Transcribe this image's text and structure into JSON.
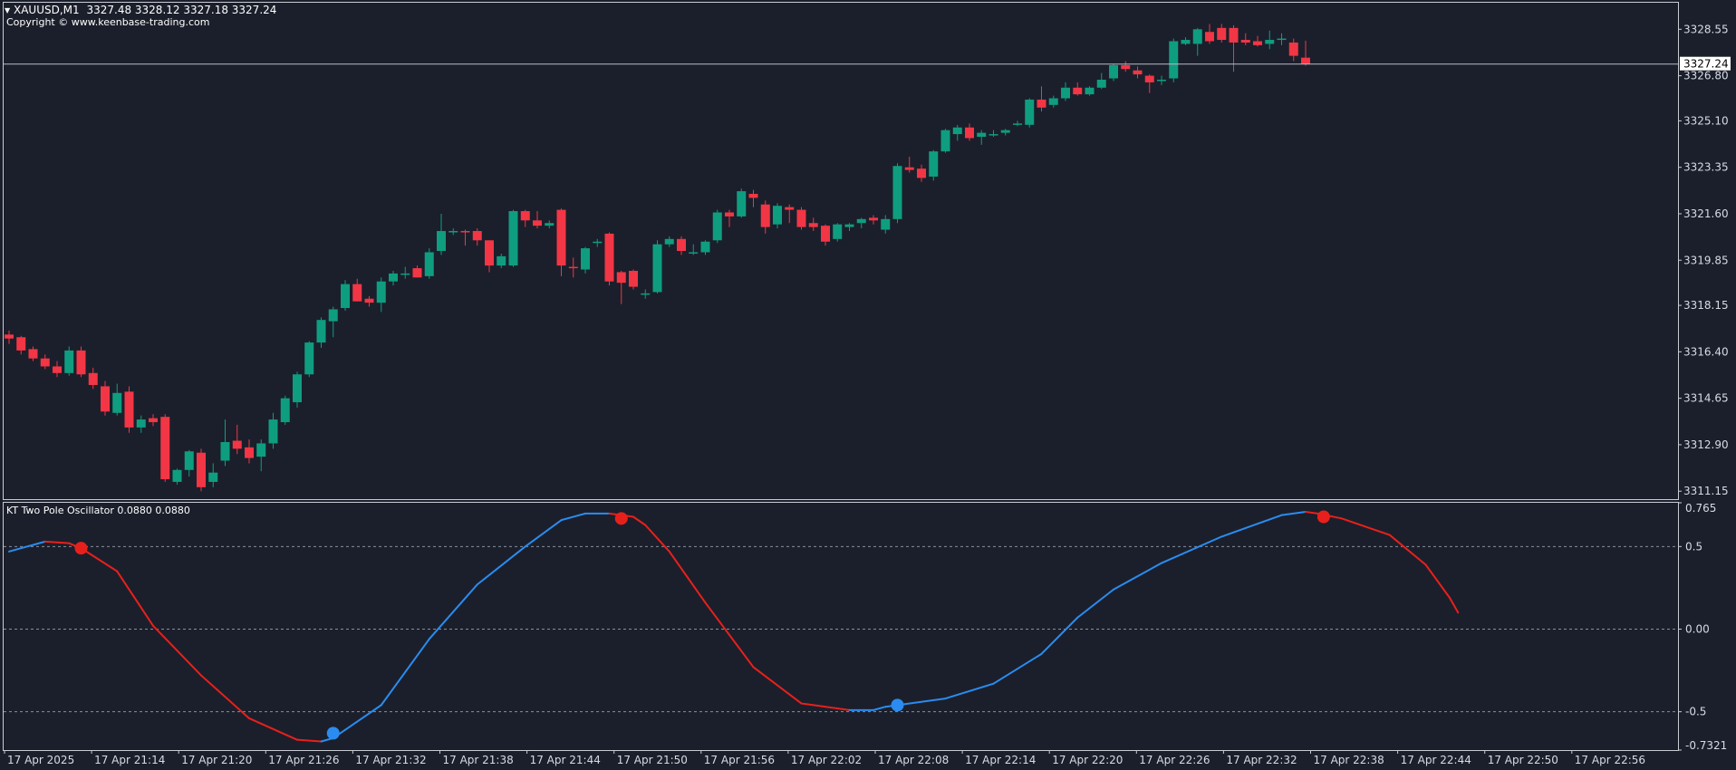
{
  "header": {
    "symbol": "XAUUSD,M1",
    "ohlc": "3327.48 3328.12 3327.18 3327.24",
    "copyright": "Copyright © www.keenbase-trading.com"
  },
  "indicator": {
    "label": "KT Two Pole Oscillator 0.0880 0.0880"
  },
  "chart_data": [
    {
      "type": "candlestick",
      "title": "XAUUSD,M1",
      "price_ticks": [
        3328.55,
        3326.8,
        3325.1,
        3323.35,
        3321.6,
        3319.85,
        3318.15,
        3316.4,
        3314.65,
        3312.9,
        3311.15
      ],
      "price_tick_labels": [
        "3328.55",
        "3326.80",
        "3325.10",
        "3323.35",
        "3321.60",
        "3319.85",
        "3318.15",
        "3316.40",
        "3314.65",
        "3312.90",
        "3311.15"
      ],
      "ylim": [
        3310.85,
        3329.55
      ],
      "current_price": 3327.24,
      "current_price_label": "3327.24",
      "time_labels": [
        "17 Apr 2025",
        "17 Apr 21:14",
        "17 Apr 21:20",
        "17 Apr 21:26",
        "17 Apr 21:32",
        "17 Apr 21:38",
        "17 Apr 21:44",
        "17 Apr 21:50",
        "17 Apr 21:56",
        "17 Apr 22:02",
        "17 Apr 22:08",
        "17 Apr 22:14",
        "17 Apr 22:20",
        "17 Apr 22:26",
        "17 Apr 22:32",
        "17 Apr 22:38",
        "17 Apr 22:44",
        "17 Apr 22:50",
        "17 Apr 22:56"
      ],
      "bull_color": "#0f9d80",
      "bear_color": "#f23645",
      "candles": [
        [
          3317.05,
          3317.2,
          3316.7,
          3316.9
        ],
        [
          3316.95,
          3317.0,
          3316.3,
          3316.45
        ],
        [
          3316.5,
          3316.6,
          3316.05,
          3316.15
        ],
        [
          3316.15,
          3316.3,
          3315.75,
          3315.85
        ],
        [
          3315.85,
          3316.05,
          3315.45,
          3315.6
        ],
        [
          3315.6,
          3316.6,
          3315.5,
          3316.45
        ],
        [
          3316.45,
          3316.6,
          3315.45,
          3315.55
        ],
        [
          3315.6,
          3315.8,
          3315.0,
          3315.15
        ],
        [
          3315.1,
          3315.3,
          3314.0,
          3314.15
        ],
        [
          3314.1,
          3315.2,
          3314.0,
          3314.85
        ],
        [
          3314.9,
          3315.1,
          3313.35,
          3313.55
        ],
        [
          3313.55,
          3314.0,
          3313.35,
          3313.85
        ],
        [
          3313.9,
          3314.05,
          3313.6,
          3313.75
        ],
        [
          3313.95,
          3314.05,
          3311.5,
          3311.6
        ],
        [
          3311.5,
          3312.0,
          3311.4,
          3311.95
        ],
        [
          3311.95,
          3312.7,
          3311.7,
          3312.65
        ],
        [
          3312.6,
          3312.75,
          3311.15,
          3311.3
        ],
        [
          3311.5,
          3312.2,
          3311.3,
          3311.85
        ],
        [
          3312.3,
          3313.85,
          3312.1,
          3313.0
        ],
        [
          3313.05,
          3313.65,
          3312.55,
          3312.75
        ],
        [
          3312.8,
          3313.1,
          3312.2,
          3312.4
        ],
        [
          3312.45,
          3313.1,
          3311.9,
          3312.95
        ],
        [
          3312.95,
          3314.1,
          3312.75,
          3313.85
        ],
        [
          3313.75,
          3314.75,
          3313.65,
          3314.65
        ],
        [
          3314.5,
          3315.65,
          3314.3,
          3315.55
        ],
        [
          3315.55,
          3316.8,
          3315.45,
          3316.75
        ],
        [
          3316.75,
          3317.7,
          3316.55,
          3317.6
        ],
        [
          3317.55,
          3318.1,
          3316.95,
          3318.0
        ],
        [
          3318.05,
          3319.1,
          3317.95,
          3318.95
        ],
        [
          3318.95,
          3319.15,
          3318.3,
          3318.3
        ],
        [
          3318.4,
          3318.5,
          3318.1,
          3318.25
        ],
        [
          3318.25,
          3319.2,
          3317.9,
          3319.05
        ],
        [
          3319.05,
          3319.45,
          3318.9,
          3319.35
        ],
        [
          3319.3,
          3319.6,
          3319.15,
          3319.35
        ],
        [
          3319.55,
          3319.65,
          3319.2,
          3319.2
        ],
        [
          3319.25,
          3320.3,
          3319.15,
          3320.15
        ],
        [
          3320.2,
          3321.6,
          3320.05,
          3320.95
        ],
        [
          3320.95,
          3321.05,
          3320.8,
          3320.95
        ],
        [
          3320.95,
          3321.0,
          3320.4,
          3320.9
        ],
        [
          3320.95,
          3321.05,
          3320.4,
          3320.6
        ],
        [
          3320.6,
          3320.6,
          3319.4,
          3319.65
        ],
        [
          3319.65,
          3320.1,
          3319.55,
          3320.0
        ],
        [
          3319.65,
          3321.75,
          3319.6,
          3321.7
        ],
        [
          3321.7,
          3321.75,
          3321.1,
          3321.35
        ],
        [
          3321.35,
          3321.7,
          3321.05,
          3321.15
        ],
        [
          3321.15,
          3321.35,
          3321.05,
          3321.25
        ],
        [
          3321.75,
          3321.8,
          3319.25,
          3319.65
        ],
        [
          3319.6,
          3319.95,
          3319.2,
          3319.55
        ],
        [
          3319.5,
          3320.35,
          3319.35,
          3320.3
        ],
        [
          3320.5,
          3320.65,
          3320.35,
          3320.55
        ],
        [
          3320.85,
          3320.9,
          3318.9,
          3319.05
        ],
        [
          3319.4,
          3319.45,
          3318.2,
          3319.0
        ],
        [
          3319.45,
          3319.5,
          3318.75,
          3318.85
        ],
        [
          3318.55,
          3318.75,
          3318.4,
          3318.6
        ],
        [
          3318.65,
          3320.6,
          3318.6,
          3320.45
        ],
        [
          3320.45,
          3320.75,
          3320.35,
          3320.65
        ],
        [
          3320.65,
          3320.75,
          3320.05,
          3320.2
        ],
        [
          3320.15,
          3320.45,
          3320.05,
          3320.15
        ],
        [
          3320.15,
          3320.6,
          3320.05,
          3320.55
        ],
        [
          3320.6,
          3321.75,
          3320.5,
          3321.65
        ],
        [
          3321.65,
          3321.75,
          3321.1,
          3321.5
        ],
        [
          3321.5,
          3322.55,
          3321.45,
          3322.45
        ],
        [
          3322.35,
          3322.5,
          3321.85,
          3322.2
        ],
        [
          3321.95,
          3322.1,
          3320.85,
          3321.1
        ],
        [
          3321.2,
          3322.0,
          3321.05,
          3321.9
        ],
        [
          3321.85,
          3321.95,
          3321.25,
          3321.75
        ],
        [
          3321.75,
          3321.85,
          3321.0,
          3321.1
        ],
        [
          3321.25,
          3321.45,
          3320.95,
          3321.1
        ],
        [
          3321.15,
          3321.2,
          3320.4,
          3320.55
        ],
        [
          3320.65,
          3321.25,
          3320.55,
          3321.2
        ],
        [
          3321.1,
          3321.25,
          3320.95,
          3321.2
        ],
        [
          3321.25,
          3321.45,
          3321.05,
          3321.4
        ],
        [
          3321.45,
          3321.55,
          3321.2,
          3321.35
        ],
        [
          3321.0,
          3321.55,
          3320.85,
          3321.4
        ],
        [
          3321.4,
          3323.5,
          3321.25,
          3323.4
        ],
        [
          3323.35,
          3323.75,
          3323.15,
          3323.25
        ],
        [
          3323.3,
          3323.45,
          3322.8,
          3322.95
        ],
        [
          3323.0,
          3324.0,
          3322.85,
          3323.95
        ],
        [
          3323.95,
          3324.8,
          3323.9,
          3324.75
        ],
        [
          3324.6,
          3324.95,
          3324.35,
          3324.85
        ],
        [
          3324.85,
          3325.0,
          3324.35,
          3324.45
        ],
        [
          3324.5,
          3324.75,
          3324.2,
          3324.65
        ],
        [
          3324.6,
          3324.75,
          3324.5,
          3324.6
        ],
        [
          3324.65,
          3324.8,
          3324.55,
          3324.75
        ],
        [
          3324.95,
          3325.1,
          3324.9,
          3325.0
        ],
        [
          3324.95,
          3325.95,
          3324.85,
          3325.9
        ],
        [
          3325.9,
          3326.4,
          3325.45,
          3325.6
        ],
        [
          3325.7,
          3326.05,
          3325.6,
          3325.95
        ],
        [
          3325.95,
          3326.55,
          3325.85,
          3326.35
        ],
        [
          3326.35,
          3326.55,
          3326.05,
          3326.1
        ],
        [
          3326.1,
          3326.4,
          3326.05,
          3326.35
        ],
        [
          3326.35,
          3326.9,
          3326.3,
          3326.65
        ],
        [
          3326.7,
          3327.25,
          3326.6,
          3327.2
        ],
        [
          3327.2,
          3327.35,
          3326.95,
          3327.05
        ],
        [
          3327.0,
          3327.15,
          3326.7,
          3326.85
        ],
        [
          3326.8,
          3326.85,
          3326.15,
          3326.55
        ],
        [
          3326.6,
          3326.8,
          3326.45,
          3326.65
        ],
        [
          3326.7,
          3328.2,
          3326.55,
          3328.1
        ],
        [
          3328.0,
          3328.25,
          3327.95,
          3328.15
        ],
        [
          3328.0,
          3328.6,
          3327.55,
          3328.55
        ],
        [
          3328.45,
          3328.75,
          3328.0,
          3328.1
        ],
        [
          3328.6,
          3328.75,
          3328.05,
          3328.15
        ],
        [
          3328.6,
          3328.7,
          3326.95,
          3328.05
        ],
        [
          3328.15,
          3328.4,
          3327.95,
          3328.05
        ],
        [
          3328.1,
          3328.3,
          3327.9,
          3327.95
        ],
        [
          3328.0,
          3328.5,
          3327.8,
          3328.15
        ],
        [
          3328.2,
          3328.4,
          3327.95,
          3328.2
        ],
        [
          3328.05,
          3328.2,
          3327.35,
          3327.55
        ],
        [
          3327.48,
          3328.12,
          3327.18,
          3327.24
        ]
      ]
    },
    {
      "type": "line",
      "title": "KT Two Pole Oscillator 0.0880 0.0880",
      "ylim": [
        -0.7321,
        0.765
      ],
      "ytick_labels": [
        "0.765",
        "0.5",
        "0.00",
        "-0.5",
        "-0.7321"
      ],
      "ytick_values": [
        0.765,
        0.5,
        0.0,
        -0.5,
        -0.7321
      ],
      "levels": [
        0.5,
        0.0,
        -0.5
      ],
      "rising_color": "#2a8cf0",
      "falling_color": "#e8201c",
      "x": [
        0,
        3,
        5,
        6,
        9,
        12,
        16,
        20,
        24,
        26,
        27,
        28,
        31,
        35,
        39,
        43,
        46,
        48,
        50,
        52,
        53,
        55,
        58,
        62,
        66,
        70,
        72,
        73,
        74,
        78,
        82,
        86,
        89,
        92,
        96,
        101,
        106,
        108,
        109,
        111,
        115,
        118,
        120,
        120.7
      ],
      "y": [
        0.47,
        0.53,
        0.52,
        0.49,
        0.35,
        0.02,
        -0.28,
        -0.54,
        -0.67,
        -0.68,
        -0.66,
        -0.61,
        -0.46,
        -0.06,
        0.27,
        0.5,
        0.66,
        0.7,
        0.7,
        0.68,
        0.63,
        0.47,
        0.16,
        -0.23,
        -0.45,
        -0.49,
        -0.49,
        -0.47,
        -0.46,
        -0.42,
        -0.33,
        -0.15,
        0.07,
        0.24,
        0.4,
        0.56,
        0.69,
        0.71,
        0.7,
        0.67,
        0.57,
        0.39,
        0.19,
        0.1
      ],
      "markers": [
        {
          "x": 6,
          "y": 0.49,
          "kind": "sell"
        },
        {
          "x": 27,
          "y": -0.63,
          "kind": "buy"
        },
        {
          "x": 51,
          "y": 0.67,
          "kind": "sell"
        },
        {
          "x": 74,
          "y": -0.46,
          "kind": "buy"
        },
        {
          "x": 109.5,
          "y": 0.68,
          "kind": "sell"
        }
      ]
    }
  ]
}
